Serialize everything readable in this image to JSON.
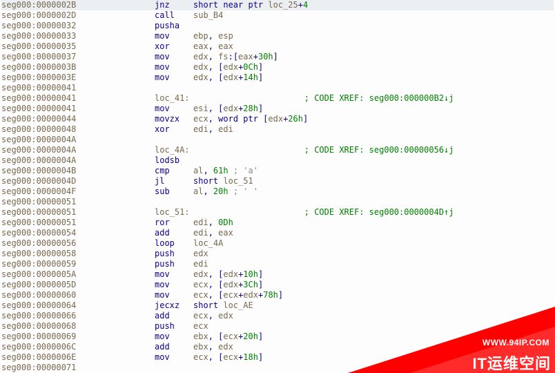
{
  "watermark": {
    "url": "WWW.94IP.COM",
    "brand": "IT运维空间"
  },
  "labels": {
    "loc_41": "loc_41:",
    "loc_4A": "loc_4A:",
    "loc_51": "loc_51:"
  },
  "xref_prefix": "; CODE XREF: ",
  "lines": [
    {
      "addr": "seg000:0000002B",
      "hl": true,
      "kind": "ins",
      "mn": "jnz",
      "ops": [
        {
          "t": "short near ptr ",
          "cls": "navy"
        },
        {
          "t": "loc_25",
          "cls": "olive"
        },
        {
          "t": "+",
          "cls": "navy"
        },
        {
          "t": "4",
          "cls": "green"
        }
      ]
    },
    {
      "addr": "seg000:0000002D",
      "kind": "ins",
      "mn": "call",
      "ops": [
        {
          "t": "sub_B4",
          "cls": "olive"
        }
      ]
    },
    {
      "addr": "seg000:00000032",
      "kind": "ins",
      "mn": "pusha",
      "ops": []
    },
    {
      "addr": "seg000:00000033",
      "kind": "ins",
      "mn": "mov",
      "ops": [
        {
          "t": "ebp",
          "cls": "olive"
        },
        {
          "t": ", ",
          "cls": "navy"
        },
        {
          "t": "esp",
          "cls": "olive"
        }
      ]
    },
    {
      "addr": "seg000:00000035",
      "kind": "ins",
      "mn": "xor",
      "ops": [
        {
          "t": "eax",
          "cls": "olive"
        },
        {
          "t": ", ",
          "cls": "navy"
        },
        {
          "t": "eax",
          "cls": "olive"
        }
      ]
    },
    {
      "addr": "seg000:00000037",
      "kind": "ins",
      "mn": "mov",
      "ops": [
        {
          "t": "edx",
          "cls": "olive"
        },
        {
          "t": ", ",
          "cls": "navy"
        },
        {
          "t": "fs",
          "cls": "olive"
        },
        {
          "t": ":[",
          "cls": "navy"
        },
        {
          "t": "eax",
          "cls": "olive"
        },
        {
          "t": "+",
          "cls": "navy"
        },
        {
          "t": "30h",
          "cls": "green"
        },
        {
          "t": "]",
          "cls": "navy"
        }
      ]
    },
    {
      "addr": "seg000:0000003B",
      "kind": "ins",
      "mn": "mov",
      "ops": [
        {
          "t": "edx",
          "cls": "olive"
        },
        {
          "t": ", [",
          "cls": "navy"
        },
        {
          "t": "edx",
          "cls": "olive"
        },
        {
          "t": "+",
          "cls": "navy"
        },
        {
          "t": "0Ch",
          "cls": "green"
        },
        {
          "t": "]",
          "cls": "navy"
        }
      ]
    },
    {
      "addr": "seg000:0000003E",
      "kind": "ins",
      "mn": "mov",
      "ops": [
        {
          "t": "edx",
          "cls": "olive"
        },
        {
          "t": ", [",
          "cls": "navy"
        },
        {
          "t": "edx",
          "cls": "olive"
        },
        {
          "t": "+",
          "cls": "navy"
        },
        {
          "t": "14h",
          "cls": "green"
        },
        {
          "t": "]",
          "cls": "navy"
        }
      ]
    },
    {
      "addr": "seg000:00000041",
      "kind": "blank"
    },
    {
      "addr": "seg000:00000041",
      "kind": "labelxref",
      "label": "loc_41",
      "xref": "seg000:000000B2↓j"
    },
    {
      "addr": "seg000:00000041",
      "kind": "ins",
      "mn": "mov",
      "ops": [
        {
          "t": "esi",
          "cls": "olive"
        },
        {
          "t": ", [",
          "cls": "navy"
        },
        {
          "t": "edx",
          "cls": "olive"
        },
        {
          "t": "+",
          "cls": "navy"
        },
        {
          "t": "28h",
          "cls": "green"
        },
        {
          "t": "]",
          "cls": "navy"
        }
      ]
    },
    {
      "addr": "seg000:00000044",
      "kind": "ins",
      "mn": "movzx",
      "ops": [
        {
          "t": "ecx",
          "cls": "olive"
        },
        {
          "t": ", ",
          "cls": "navy"
        },
        {
          "t": "word ptr",
          "cls": "navy"
        },
        {
          "t": " [",
          "cls": "navy"
        },
        {
          "t": "edx",
          "cls": "olive"
        },
        {
          "t": "+",
          "cls": "navy"
        },
        {
          "t": "26h",
          "cls": "green"
        },
        {
          "t": "]",
          "cls": "navy"
        }
      ]
    },
    {
      "addr": "seg000:00000048",
      "kind": "ins",
      "mn": "xor",
      "ops": [
        {
          "t": "edi",
          "cls": "olive"
        },
        {
          "t": ", ",
          "cls": "navy"
        },
        {
          "t": "edi",
          "cls": "olive"
        }
      ]
    },
    {
      "addr": "seg000:0000004A",
      "kind": "blank"
    },
    {
      "addr": "seg000:0000004A",
      "kind": "labelxref",
      "label": "loc_4A",
      "xref": "seg000:00000056↓j"
    },
    {
      "addr": "seg000:0000004A",
      "kind": "ins",
      "mn": "lodsb",
      "ops": []
    },
    {
      "addr": "seg000:0000004B",
      "kind": "ins",
      "mn": "cmp",
      "ops": [
        {
          "t": "al",
          "cls": "olive"
        },
        {
          "t": ", ",
          "cls": "navy"
        },
        {
          "t": "61h",
          "cls": "green"
        },
        {
          "t": " ; 'a'",
          "cls": "gray"
        }
      ]
    },
    {
      "addr": "seg000:0000004D",
      "kind": "ins",
      "mn": "jl",
      "ops": [
        {
          "t": "short ",
          "cls": "navy"
        },
        {
          "t": "loc_51",
          "cls": "olive"
        }
      ]
    },
    {
      "addr": "seg000:0000004F",
      "kind": "ins",
      "mn": "sub",
      "ops": [
        {
          "t": "al",
          "cls": "olive"
        },
        {
          "t": ", ",
          "cls": "navy"
        },
        {
          "t": "20h",
          "cls": "green"
        },
        {
          "t": " ; ' '",
          "cls": "gray"
        }
      ]
    },
    {
      "addr": "seg000:00000051",
      "kind": "blank"
    },
    {
      "addr": "seg000:00000051",
      "kind": "labelxref",
      "label": "loc_51",
      "xref": "seg000:0000004D↑j"
    },
    {
      "addr": "seg000:00000051",
      "kind": "ins",
      "mn": "ror",
      "ops": [
        {
          "t": "edi",
          "cls": "olive"
        },
        {
          "t": ", ",
          "cls": "navy"
        },
        {
          "t": "0Dh",
          "cls": "green"
        }
      ]
    },
    {
      "addr": "seg000:00000054",
      "kind": "ins",
      "mn": "add",
      "ops": [
        {
          "t": "edi",
          "cls": "olive"
        },
        {
          "t": ", ",
          "cls": "navy"
        },
        {
          "t": "eax",
          "cls": "olive"
        }
      ]
    },
    {
      "addr": "seg000:00000056",
      "kind": "ins",
      "mn": "loop",
      "ops": [
        {
          "t": "loc_4A",
          "cls": "olive"
        }
      ]
    },
    {
      "addr": "seg000:00000058",
      "kind": "ins",
      "mn": "push",
      "ops": [
        {
          "t": "edx",
          "cls": "olive"
        }
      ]
    },
    {
      "addr": "seg000:00000059",
      "kind": "ins",
      "mn": "push",
      "ops": [
        {
          "t": "edi",
          "cls": "olive"
        }
      ]
    },
    {
      "addr": "seg000:0000005A",
      "kind": "ins",
      "mn": "mov",
      "ops": [
        {
          "t": "edx",
          "cls": "olive"
        },
        {
          "t": ", [",
          "cls": "navy"
        },
        {
          "t": "edx",
          "cls": "olive"
        },
        {
          "t": "+",
          "cls": "navy"
        },
        {
          "t": "10h",
          "cls": "green"
        },
        {
          "t": "]",
          "cls": "navy"
        }
      ]
    },
    {
      "addr": "seg000:0000005D",
      "kind": "ins",
      "mn": "mov",
      "ops": [
        {
          "t": "ecx",
          "cls": "olive"
        },
        {
          "t": ", [",
          "cls": "navy"
        },
        {
          "t": "edx",
          "cls": "olive"
        },
        {
          "t": "+",
          "cls": "navy"
        },
        {
          "t": "3Ch",
          "cls": "green"
        },
        {
          "t": "]",
          "cls": "navy"
        }
      ]
    },
    {
      "addr": "seg000:00000060",
      "kind": "ins",
      "mn": "mov",
      "ops": [
        {
          "t": "ecx",
          "cls": "olive"
        },
        {
          "t": ", [",
          "cls": "navy"
        },
        {
          "t": "ecx",
          "cls": "olive"
        },
        {
          "t": "+",
          "cls": "navy"
        },
        {
          "t": "edx",
          "cls": "olive"
        },
        {
          "t": "+",
          "cls": "navy"
        },
        {
          "t": "78h",
          "cls": "green"
        },
        {
          "t": "]",
          "cls": "navy"
        }
      ]
    },
    {
      "addr": "seg000:00000064",
      "kind": "ins",
      "mn": "jecxz",
      "ops": [
        {
          "t": "short ",
          "cls": "navy"
        },
        {
          "t": "loc_AE",
          "cls": "olive"
        }
      ]
    },
    {
      "addr": "seg000:00000066",
      "kind": "ins",
      "mn": "add",
      "ops": [
        {
          "t": "ecx",
          "cls": "olive"
        },
        {
          "t": ", ",
          "cls": "navy"
        },
        {
          "t": "edx",
          "cls": "olive"
        }
      ]
    },
    {
      "addr": "seg000:00000068",
      "kind": "ins",
      "mn": "push",
      "ops": [
        {
          "t": "ecx",
          "cls": "olive"
        }
      ]
    },
    {
      "addr": "seg000:00000069",
      "kind": "ins",
      "mn": "mov",
      "ops": [
        {
          "t": "ebx",
          "cls": "olive"
        },
        {
          "t": ", [",
          "cls": "navy"
        },
        {
          "t": "ecx",
          "cls": "olive"
        },
        {
          "t": "+",
          "cls": "navy"
        },
        {
          "t": "20h",
          "cls": "green"
        },
        {
          "t": "]",
          "cls": "navy"
        }
      ]
    },
    {
      "addr": "seg000:0000006C",
      "kind": "ins",
      "mn": "add",
      "ops": [
        {
          "t": "ebx",
          "cls": "olive"
        },
        {
          "t": ", ",
          "cls": "navy"
        },
        {
          "t": "edx",
          "cls": "olive"
        }
      ]
    },
    {
      "addr": "seg000:0000006E",
      "kind": "ins",
      "mn": "mov",
      "ops": [
        {
          "t": "ecx",
          "cls": "olive"
        },
        {
          "t": ", [",
          "cls": "navy"
        },
        {
          "t": "ecx",
          "cls": "olive"
        },
        {
          "t": "+",
          "cls": "navy"
        },
        {
          "t": "18h",
          "cls": "green"
        },
        {
          "t": "]",
          "cls": "navy"
        }
      ]
    },
    {
      "addr": "seg000:00000071",
      "kind": "blank"
    }
  ]
}
